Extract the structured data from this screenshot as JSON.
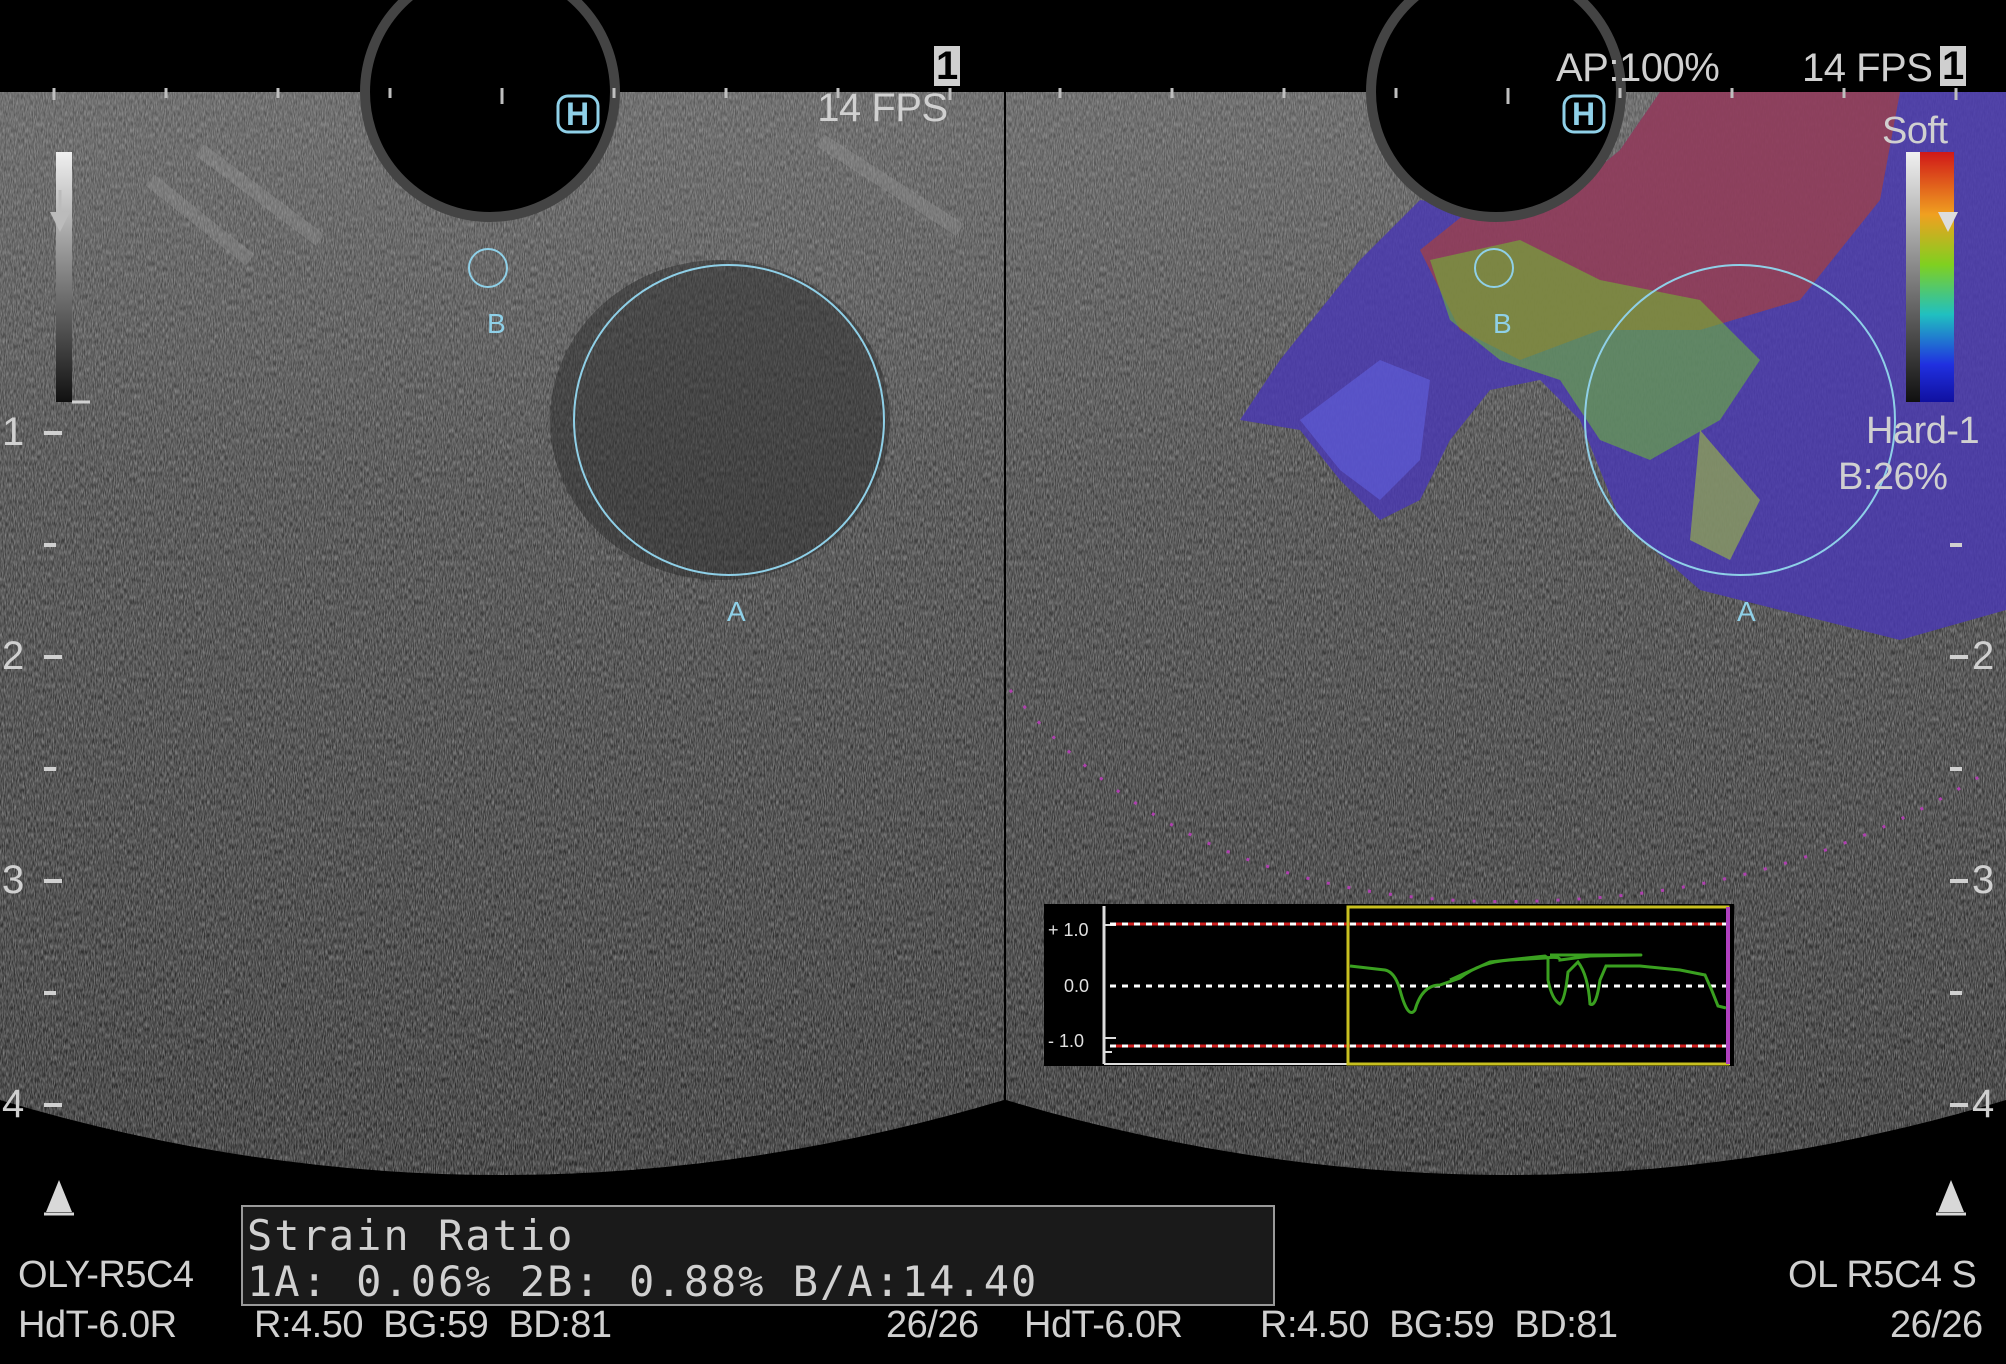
{
  "header": {
    "left_fps": "14 FPS",
    "left_fps_index": "1",
    "ap": "AP:100%",
    "right_fps": "14 FPS",
    "right_fps_index": "1"
  },
  "markers": {
    "h_left": "H",
    "h_right": "H",
    "roi_a_left": "A",
    "roi_b_left": "B",
    "roi_a_right": "A",
    "roi_b_right": "B"
  },
  "depth_scale": {
    "left": [
      "1",
      "2",
      "3",
      "4"
    ],
    "right": [
      "2",
      "3",
      "4"
    ]
  },
  "elasto_scale": {
    "soft": "Soft",
    "hard": "Hard-1",
    "b_percent": "B:26%"
  },
  "graph": {
    "top_label": "+ 1.0",
    "mid_label": "0.0",
    "bottom_label": "- 1.0"
  },
  "strain_ratio": {
    "title": "Strain Ratio",
    "line": "1A:    0.06% 2B:    0.88%  B/A:14.40"
  },
  "footer": {
    "left_probe": "OLY-R5C4",
    "left_freq": "HdT-6.0R",
    "left_params": "R:4.50  BG:59  BD:81",
    "left_frames": "26/26",
    "right_freq": "HdT-6.0R",
    "right_params": "R:4.50  BG:59  BD:81",
    "right_probe": "OL R5C4 S",
    "right_frames": "26/26"
  },
  "colors": {
    "roi_circle": "#8fd0e8",
    "graph_window": "#c8c020",
    "graph_trace": "#3aa020",
    "graph_end": "#b040c0"
  }
}
